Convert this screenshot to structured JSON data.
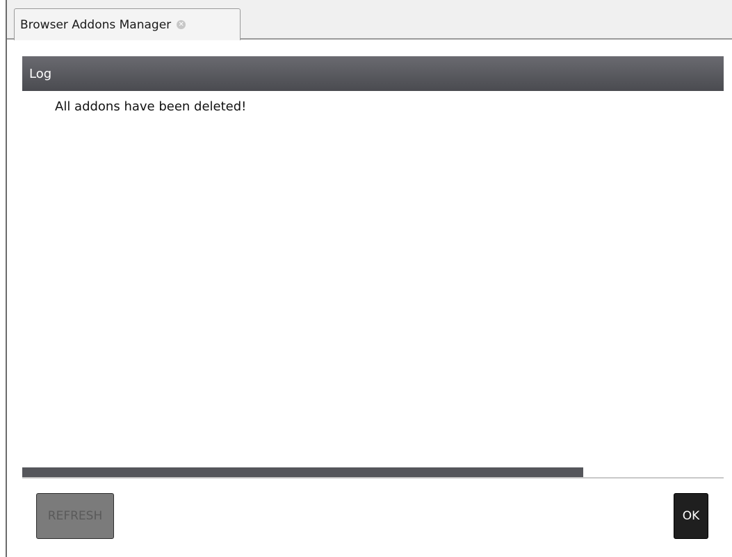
{
  "window": {
    "tab_title": "Browser Addons Manager",
    "tab_close_icon": "close-circle-icon"
  },
  "log": {
    "header": "Log",
    "lines": [
      "All addons have been deleted!"
    ]
  },
  "progress": {
    "fraction": 0.8
  },
  "buttons": {
    "refresh_label": "REFRESH",
    "refresh_enabled": false,
    "ok_label": "OK"
  },
  "colors": {
    "header_bg": "#55565b",
    "progress_fill": "#55565b",
    "ok_bg": "#1f1f1f",
    "refresh_disabled_bg": "#7b7b7b"
  }
}
